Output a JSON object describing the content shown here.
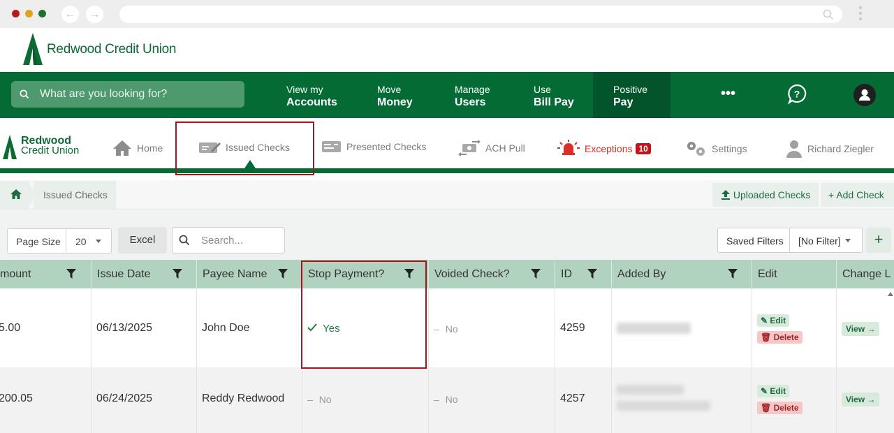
{
  "browser": {
    "back_icon": "arrow-left-icon",
    "forward_icon": "arrow-right-icon",
    "search_icon": "search-icon"
  },
  "brand": {
    "name": "Redwood Credit Union",
    "sub_line1": "Redwood",
    "sub_line2": "Credit Union",
    "color": "#046b34"
  },
  "mainnav": {
    "search_placeholder": "What are you looking for?",
    "items": [
      {
        "line1": "View my",
        "line2": "Accounts"
      },
      {
        "line1": "Move",
        "line2": "Money"
      },
      {
        "line1": "Manage",
        "line2": "Users"
      },
      {
        "line1": "Use",
        "line2": "Bill Pay"
      },
      {
        "line1": "Positive",
        "line2": "Pay"
      }
    ],
    "more_label": "•••",
    "active_index": 4
  },
  "subnav": {
    "home": "Home",
    "issued": "Issued Checks",
    "presented": "Presented Checks",
    "ach": "ACH Pull",
    "exceptions": "Exceptions",
    "exceptions_count": "10",
    "settings": "Settings",
    "user": "Richard Ziegler"
  },
  "breadcrumb": {
    "current": "Issued Checks",
    "uploaded_label": "Uploaded Checks",
    "add_label": "Add Check"
  },
  "toolbar": {
    "page_size_label": "Page Size",
    "page_size_value": "20",
    "excel_label": "Excel",
    "search_placeholder": "Search...",
    "saved_filters_label": "Saved Filters",
    "filter_value": "[No Filter]",
    "add_filter": "+"
  },
  "table": {
    "headers": [
      "mount",
      "Issue Date",
      "Payee Name",
      "Stop Payment?",
      "Voided Check?",
      "ID",
      "Added By",
      "Edit",
      "Change L"
    ],
    "rows": [
      {
        "amount": "5.00",
        "issue_date": "06/13/2025",
        "payee": "John Doe",
        "stop": "Yes",
        "voided": "No",
        "id": "4259"
      },
      {
        "amount": "200.05",
        "issue_date": "06/24/2025",
        "payee": "Reddy Redwood",
        "stop": "No",
        "voided": "No",
        "id": "4257"
      }
    ],
    "edit_label": "Edit",
    "delete_label": "Delete",
    "view_label": "View →",
    "stop_yes_color": "#1f7d47"
  }
}
